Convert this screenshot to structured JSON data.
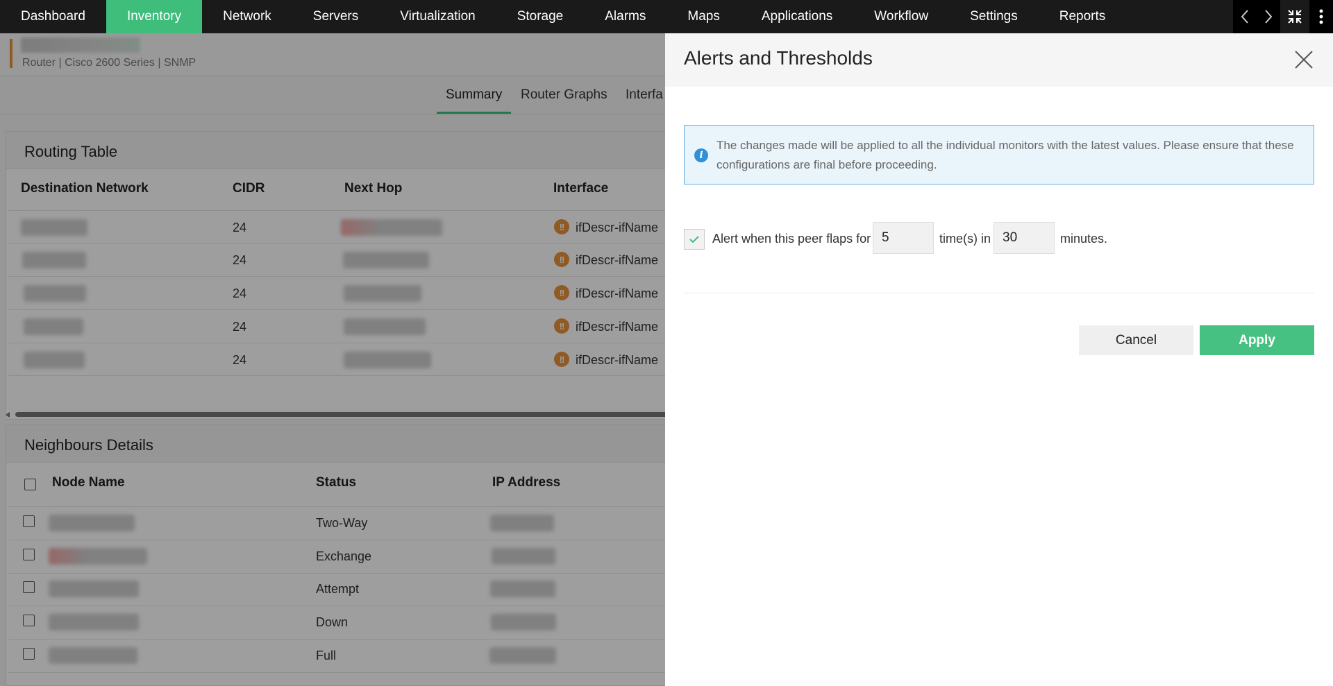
{
  "nav": {
    "items": [
      "Dashboard",
      "Inventory",
      "Network",
      "Servers",
      "Virtualization",
      "Storage",
      "Alarms",
      "Maps",
      "Applications",
      "Workflow",
      "Settings",
      "Reports"
    ],
    "active": "Inventory"
  },
  "device": {
    "subtitle": "Router | Cisco 2600 Series  | SNMP"
  },
  "subtabs": [
    "Summary",
    "Router Graphs",
    "Interfa"
  ],
  "routing_table": {
    "title": "Routing Table",
    "columns": [
      "Destination Network",
      "CIDR",
      "Next Hop",
      "Interface"
    ],
    "rows": [
      {
        "cidr": "24",
        "interface": "ifDescr-ifName"
      },
      {
        "cidr": "24",
        "interface": "ifDescr-ifName"
      },
      {
        "cidr": "24",
        "interface": "ifDescr-ifName"
      },
      {
        "cidr": "24",
        "interface": "ifDescr-ifName"
      },
      {
        "cidr": "24",
        "interface": "ifDescr-ifName"
      }
    ]
  },
  "neighbours": {
    "title": "Neighbours Details",
    "columns": [
      "Node Name",
      "Status",
      "IP Address"
    ],
    "rows": [
      {
        "status": "Two-Way"
      },
      {
        "status": "Exchange"
      },
      {
        "status": "Attempt"
      },
      {
        "status": "Down"
      },
      {
        "status": "Full"
      }
    ]
  },
  "drawer": {
    "title": "Alerts and Thresholds",
    "info": "The changes made will be applied to all the individual monitors with the latest values. Please ensure that these configurations are final before proceeding.",
    "alert_prefix": "Alert when this peer flaps for",
    "times_value": "5",
    "times_label": "time(s) in",
    "minutes_value": "30",
    "minutes_label": "minutes.",
    "checked": true,
    "cancel_label": "Cancel",
    "apply_label": "Apply"
  },
  "colors": {
    "accent_green": "#3ebd7b",
    "nav_bg": "#1a1a1a",
    "warning_orange": "#e8913b",
    "info_blue": "#2f8fd8"
  },
  "icons": [
    "prev-arrow-icon",
    "next-arrow-icon",
    "collapse-icon",
    "more-vertical-icon",
    "warning-icon",
    "info-icon",
    "close-icon",
    "check-icon"
  ]
}
